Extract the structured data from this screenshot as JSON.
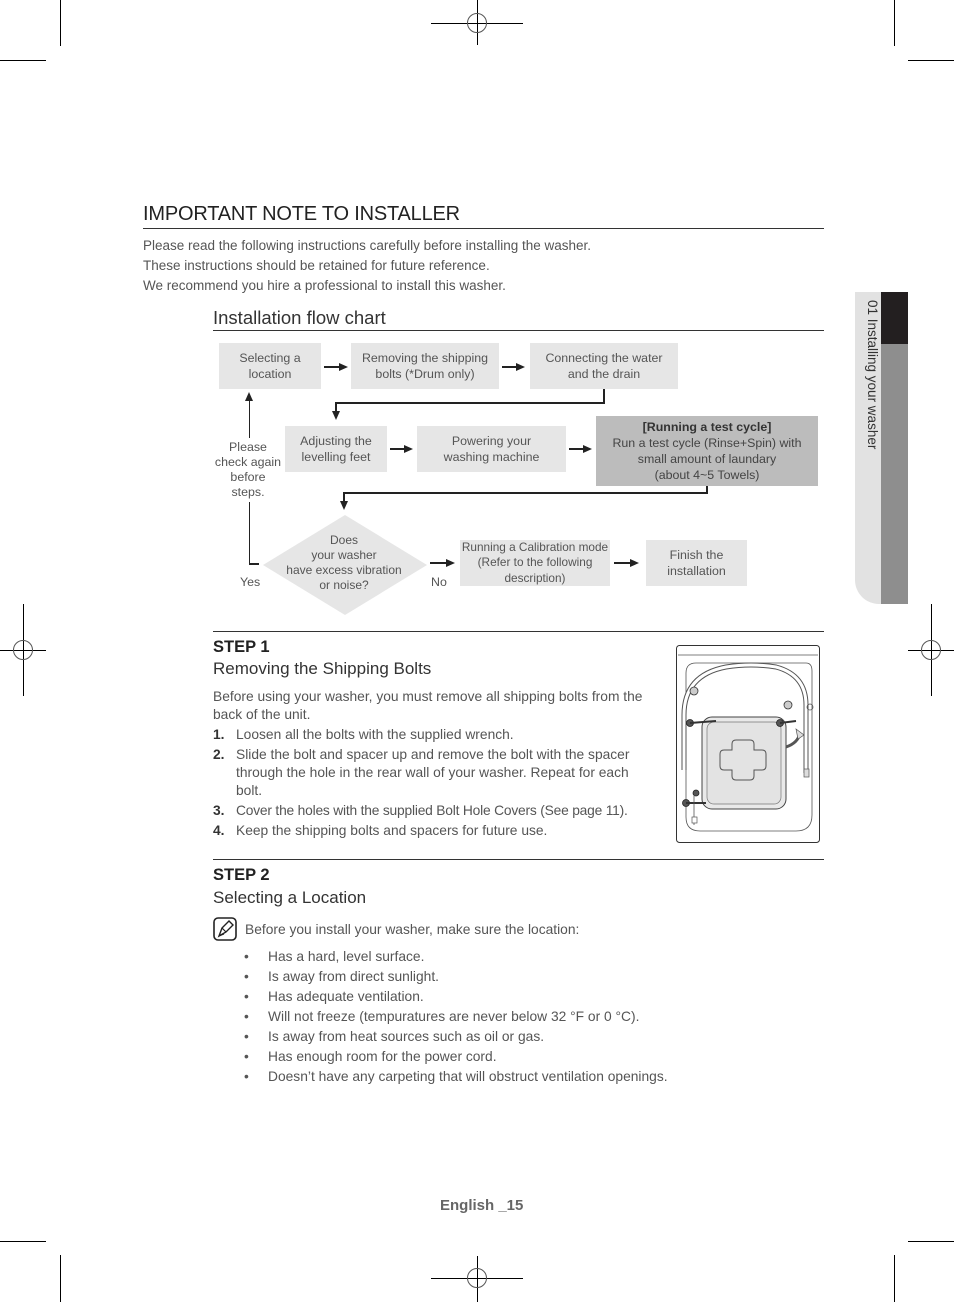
{
  "header": {
    "title": "IMPORTANT NOTE TO INSTALLER",
    "intro_lines": [
      "Please read the following instructions carefully before installing the washer.",
      "These instructions should be retained for future reference.",
      "We recommend you hire a professional to install this washer."
    ]
  },
  "flowchart": {
    "title": "Installation flow chart",
    "row1": [
      "Selecting a location",
      "Removing the shipping bolts (*Drum only)",
      "Connecting the water and the drain"
    ],
    "row2": [
      "Adjusting the levelling feet",
      "Powering your washing machine"
    ],
    "test_cycle": {
      "title": "[Running a test cycle]",
      "lines": [
        "Run a test cycle (Rinse+Spin) with",
        "small amount of laundary",
        "(about 4~5 Towels)"
      ]
    },
    "check_again": [
      "Please",
      "check again",
      "before",
      "steps."
    ],
    "decision": [
      "Does",
      "your washer",
      "have excess vibration",
      "or noise?"
    ],
    "yes_label": "Yes",
    "no_label": "No",
    "calibration": [
      "Running a Calibration mode",
      "(Refer to the following",
      "description)"
    ],
    "finish": [
      "Finish the",
      "installation"
    ]
  },
  "step1": {
    "label": "STEP 1",
    "title": "Removing the Shipping Bolts",
    "intro": "Before using your washer, you must remove all shipping bolts from the back of the unit.",
    "items": [
      {
        "num": "1.",
        "text": "Loosen all the bolts with the supplied wrench."
      },
      {
        "num": "2.",
        "text": "Slide the bolt and spacer up and remove the bolt with the spacer through the hole in the rear wall of your washer. Repeat for each bolt."
      },
      {
        "num": "3.",
        "text": "Cover the holes with the supplied Bolt Hole Covers (See page 11)."
      },
      {
        "num": "4.",
        "text": "Keep the shipping bolts and spacers for future use."
      }
    ],
    "illustration": "washer-rear-view-illustration"
  },
  "step2": {
    "label": "STEP 2",
    "title": "Selecting a Location",
    "note": "Before you install your washer, make sure the location:",
    "note_icon": "note-pencil-icon",
    "bullets": [
      "Has a hard, level surface.",
      "Is away from direct sunlight.",
      "Has adequate ventilation.",
      "Will not freeze (tempuratures are never below 32 °F or 0 °C).",
      "Is away from heat sources such as oil or gas.",
      "Has enough room for the power cord.",
      "Doesn’t have any carpeting that will obstruct ventilation openings."
    ]
  },
  "side_tab": {
    "label": "01 Installing your washer"
  },
  "footer": {
    "page": "English _15"
  },
  "colors": {
    "box_light": "#e6e6e6",
    "box_dark": "#bcbcbc",
    "tab_black": "#231f20",
    "tab_grey": "#8e8e8e"
  }
}
